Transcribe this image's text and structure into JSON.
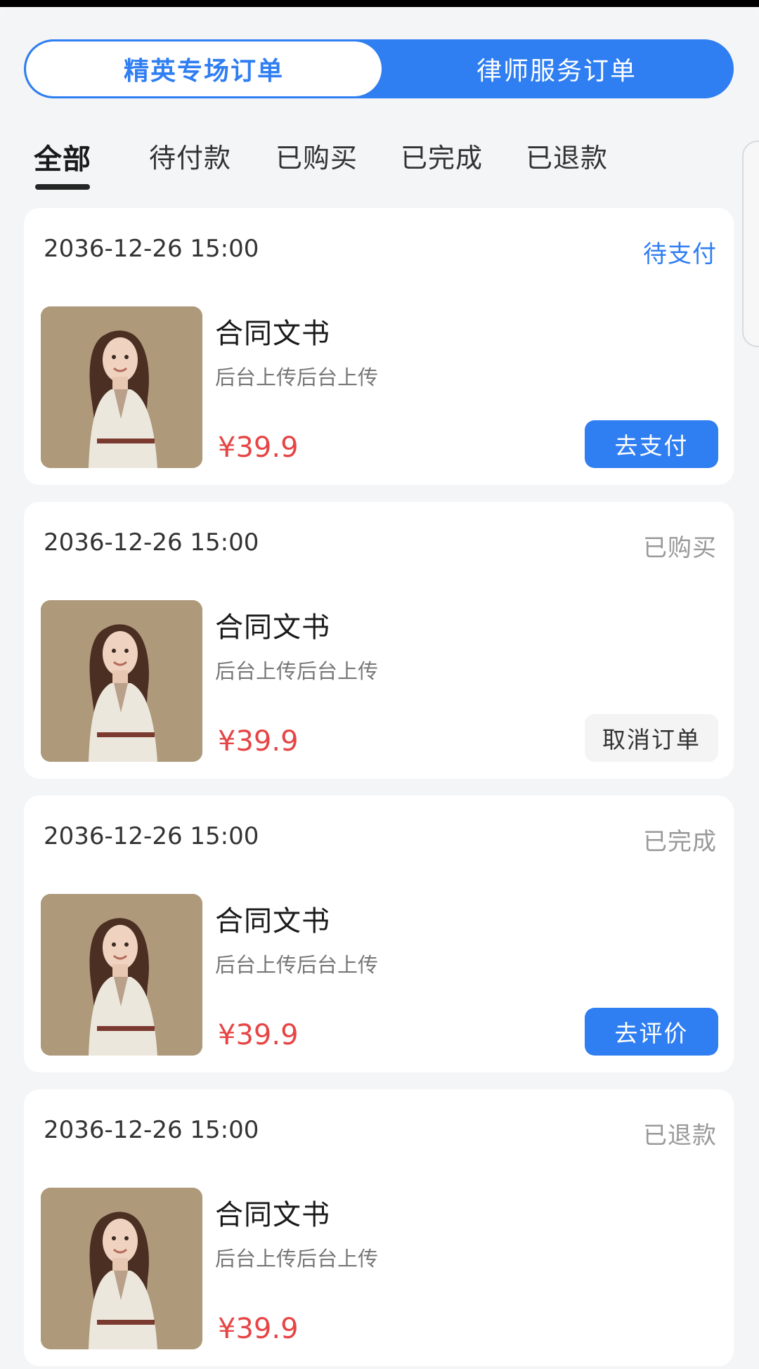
{
  "order_type_tabs": [
    {
      "label": "精英专场订单",
      "selected": true
    },
    {
      "label": "律师服务订单",
      "selected": false
    }
  ],
  "filter_tabs": [
    {
      "label": "全部",
      "selected": true
    },
    {
      "label": "待付款",
      "selected": false
    },
    {
      "label": "已购买",
      "selected": false
    },
    {
      "label": "已完成",
      "selected": false
    },
    {
      "label": "已退款",
      "selected": false
    }
  ],
  "orders": [
    {
      "time": "2036-12-26 15:00",
      "status": "待支付",
      "title": "合同文书",
      "description": "后台上传后台上传",
      "price": "¥39.9",
      "action": "去支付"
    },
    {
      "time": "2036-12-26 15:00",
      "status": "已购买",
      "title": "合同文书",
      "description": "后台上传后台上传",
      "price": "¥39.9",
      "action": "取消订单"
    },
    {
      "time": "2036-12-26 15:00",
      "status": "已完成",
      "title": "合同文书",
      "description": "后台上传后台上传",
      "price": "¥39.9",
      "action": "去评价"
    },
    {
      "time": "2036-12-26 15:00",
      "status": "已退款",
      "title": "合同文书",
      "description": "后台上传后台上传",
      "price": "¥39.9"
    }
  ],
  "colors": {
    "accent": "#2f7ef2",
    "price": "#e64545",
    "background": "#f4f5f7",
    "card": "#ffffff"
  }
}
